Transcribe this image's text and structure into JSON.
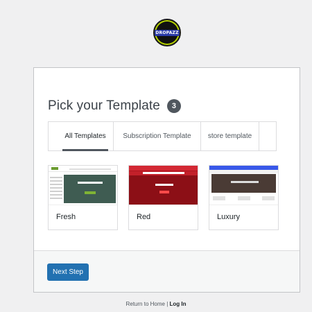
{
  "logo": {
    "text": "DROPAZZ"
  },
  "card": {
    "title": "Pick your Template",
    "count": "3",
    "tabs": [
      {
        "label": "All Templates",
        "active": true
      },
      {
        "label": "Subscription Template",
        "active": false
      },
      {
        "label": "store template",
        "active": false
      }
    ],
    "templates": [
      {
        "name": "Fresh"
      },
      {
        "name": "Red"
      },
      {
        "name": "Luxury"
      }
    ],
    "next_button": "Next Step"
  },
  "footer": {
    "home_text": "Return to Home",
    "separator": "|",
    "login_text": "Log In"
  },
  "colors": {
    "accent": "#2271b1",
    "badge": "#50575e",
    "background": "#f0f0f1"
  }
}
